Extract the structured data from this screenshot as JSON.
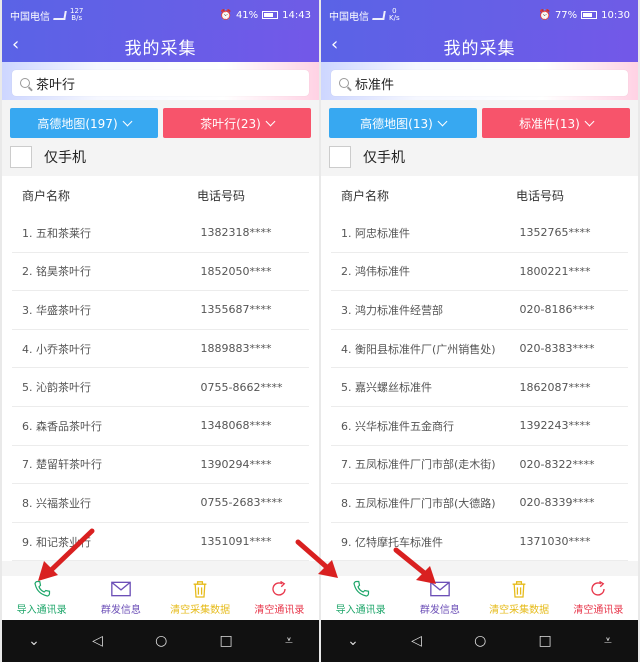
{
  "screens": [
    {
      "status": {
        "carrier": "中国电信",
        "net_speed_top": "127",
        "net_speed_bottom": "B/s",
        "battery": "41%",
        "time": "14:43"
      },
      "title": "我的采集",
      "back_glyph": "‹",
      "search": {
        "value": "茶叶行"
      },
      "filters": {
        "left": "高德地图(197)",
        "right": "茶叶行(23)"
      },
      "phone_only_label": "仅手机",
      "headers": {
        "name": "商户名称",
        "phone": "电话号码"
      },
      "rows": [
        {
          "name": "1. 五和茶莱行",
          "phone": "1382318****"
        },
        {
          "name": "2. 铭昊茶叶行",
          "phone": "1852050****"
        },
        {
          "name": "3. 华盛茶叶行",
          "phone": "1355687****"
        },
        {
          "name": "4. 小乔茶叶行",
          "phone": "1889883****"
        },
        {
          "name": "5. 沁韵茶叶行",
          "phone": "0755-8662****"
        },
        {
          "name": "6. 森香品茶叶行",
          "phone": "1348068****"
        },
        {
          "name": "7. 楚留轩茶叶行",
          "phone": "1390294****"
        },
        {
          "name": "8. 兴福茶业行",
          "phone": "0755-2683****"
        },
        {
          "name": "9. 和记茶业行",
          "phone": "1351091****"
        }
      ],
      "actions": [
        "导入通讯录",
        "群发信息",
        "清空采集数据",
        "清空通讯录"
      ]
    },
    {
      "status": {
        "carrier": "中国电信",
        "net_speed_top": "0",
        "net_speed_bottom": "K/s",
        "battery": "77%",
        "time": "10:30"
      },
      "title": "我的采集",
      "back_glyph": "‹",
      "search": {
        "value": "标准件"
      },
      "filters": {
        "left": "高德地图(13)",
        "right": "标准件(13)"
      },
      "phone_only_label": "仅手机",
      "headers": {
        "name": "商户名称",
        "phone": "电话号码"
      },
      "rows": [
        {
          "name": "1. 阿忠标准件",
          "phone": "1352765****"
        },
        {
          "name": "2. 鸿伟标准件",
          "phone": "1800221****"
        },
        {
          "name": "3. 鸿力标准件经营部",
          "phone": "020-8186****"
        },
        {
          "name": "4. 衡阳县标准件厂(广州销售处)",
          "phone": "020-8383****"
        },
        {
          "name": "5. 嘉兴螺丝标准件",
          "phone": "1862087****"
        },
        {
          "name": "6. 兴华标准件五金商行",
          "phone": "1392243****"
        },
        {
          "name": "7. 五凤标准件厂门市部(走木街)",
          "phone": "020-8322****"
        },
        {
          "name": "8. 五凤标准件厂门市部(大德路)",
          "phone": "020-8339****"
        },
        {
          "name": "9. 亿特摩托车标准件",
          "phone": "1371030****"
        }
      ],
      "actions": [
        "导入通讯录",
        "群发信息",
        "清空采集数据",
        "清空通讯录"
      ]
    }
  ],
  "colors": {
    "header_gradient": [
      "#5a63e6",
      "#7358e8"
    ],
    "filter_left": "#37a8f1",
    "filter_right": "#f7546b",
    "action_import": "#1ea66a",
    "action_broadcast": "#6c4fb7",
    "action_clear_data": "#e6bb1a",
    "action_clear_contacts": "#e8394d",
    "annotation_arrow": "#d92020"
  },
  "icons": {
    "actions": [
      "phone-icon",
      "mail-icon",
      "trash-icon",
      "refresh-icon"
    ],
    "nav": [
      "chevron-down-icon",
      "back-triangle-icon",
      "home-circle-icon",
      "recent-square-icon",
      "notification-pulldown-icon"
    ]
  }
}
